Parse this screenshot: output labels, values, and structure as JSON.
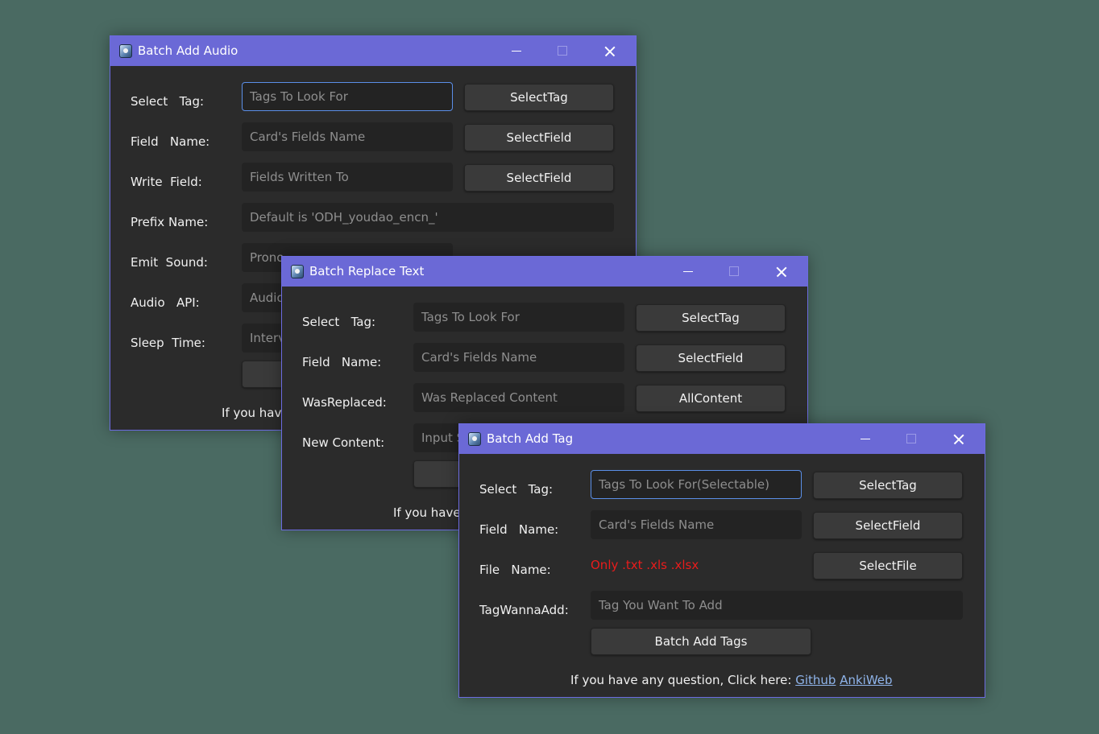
{
  "win1": {
    "title": "Batch Add Audio",
    "labels": [
      "Select   Tag:",
      "Field   Name:",
      "Write  Field:",
      "Prefix Name:",
      "Emit  Sound:",
      "Audio   API:",
      "Sleep  Time:"
    ],
    "inputs": [
      "Tags To Look For",
      "Card's Fields Name",
      "Fields Written To",
      "Default is 'ODH_youdao_encn_'",
      "Prono",
      "Audio",
      "Interv"
    ],
    "buttons": [
      "SelectTag",
      "SelectField",
      "SelectField"
    ],
    "footer": "If you have"
  },
  "win2": {
    "title": "Batch Replace Text",
    "labels": [
      "Select   Tag:",
      "Field   Name:",
      "WasReplaced:",
      "New Content:"
    ],
    "inputs": [
      "Tags To Look For",
      "Card's Fields Name",
      "Was Replaced Content",
      "Input S"
    ],
    "buttons": [
      "SelectTag",
      "SelectField",
      "AllContent"
    ],
    "footer": "If you have"
  },
  "win3": {
    "title": "Batch Add Tag",
    "labels": [
      "Select   Tag:",
      "Field   Name:",
      "File   Name:",
      "TagWannaAdd:"
    ],
    "inputs": [
      "Tags To Look For(Selectable)",
      "Card's Fields Name",
      "Tag You Want To Add"
    ],
    "file_hint": "Only .txt .xls .xlsx",
    "buttons": [
      "SelectTag",
      "SelectField",
      "SelectFile"
    ],
    "action_button": "Batch Add Tags",
    "footer": {
      "text": "If you have any question, Click here: ",
      "link1": "Github",
      "link2": "AnkiWeb"
    }
  },
  "colors": {
    "desktop": "#4a6a62",
    "titlebar": "#6b69d6",
    "window_bg": "#2b2b2b",
    "focus_border": "#5b8fe8",
    "error_text": "#e81c1c",
    "link": "#8fb4ea"
  }
}
